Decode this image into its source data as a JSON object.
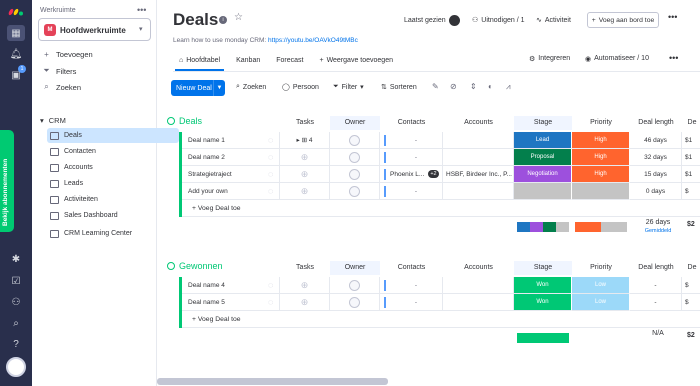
{
  "workspace": {
    "label": "Werkruimte",
    "name": "Hoofdwerkruimte",
    "icon_letter": "M",
    "actions": [
      "Toevoegen",
      "Filters",
      "Zoeken"
    ],
    "folder": "CRM",
    "boards": [
      "Deals",
      "Contacten",
      "Accounts",
      "Leads",
      "Activiteiten",
      "Sales Dashboard",
      "CRM Learning Center"
    ],
    "selected_board": "Deals"
  },
  "rail": {
    "notification_count": "1",
    "subscribe_label": "Bekijk abonnementen"
  },
  "header": {
    "title": "Deals",
    "learn_text": "Learn how to use monday CRM: ",
    "learn_link": "https://youtu.be/OAVkO49tMBc",
    "last_seen": "Laatst gezien",
    "invite": "Uitnodigen / 1",
    "activity": "Activiteit",
    "add_to_board": "Voeg aan bord toe"
  },
  "tabs": [
    "Hoofdtabel",
    "Kanban",
    "Forecast"
  ],
  "add_view": "Weergave toevoegen",
  "integrate": "Integreren",
  "automate": "Automatiseer / 10",
  "toolbar": {
    "new_item": "Nieuw Deal",
    "search": "Zoeken",
    "person": "Persoon",
    "filter": "Filter",
    "sort": "Sorteren"
  },
  "columns": [
    "Tasks",
    "Owner",
    "Contacts",
    "Accounts",
    "Stage",
    "Priority",
    "Deal length",
    "De"
  ],
  "groups": [
    {
      "title": "Deals",
      "color": "#00c875",
      "rows": [
        {
          "name": "Deal name 1",
          "tasks": "4",
          "contacts": "-",
          "accounts": "",
          "stage": "Lead",
          "stage_color": "#1f76c2",
          "priority": "High",
          "priority_color": "#ff642e",
          "length": "46 days",
          "de": "$1"
        },
        {
          "name": "Deal name 2",
          "tasks": "",
          "contacts": "-",
          "accounts": "",
          "stage": "Proposal",
          "stage_color": "#037f4c",
          "priority": "High",
          "priority_color": "#ff642e",
          "length": "32 days",
          "de": "$1"
        },
        {
          "name": "Strategietraject",
          "tasks": "",
          "contacts": "Phoenix L...",
          "contacts_extra": "+2",
          "accounts": "HSBF, Birdeer Inc., P...",
          "stage": "Negotiation",
          "stage_color": "#9d50dd",
          "priority": "High",
          "priority_color": "#ff642e",
          "length": "15 days",
          "de": "$1"
        },
        {
          "name": "Add your own",
          "tasks": "",
          "contacts": "-",
          "accounts": "",
          "stage": "",
          "stage_color": "#c4c4c4",
          "priority": "",
          "priority_color": "#c4c4c4",
          "length": "0 days",
          "de": "$"
        }
      ],
      "add_label": "+ Voeg Deal toe",
      "summary_length": "26 days",
      "summary_sub": "Gemiddeld",
      "summary_de": "$2",
      "stage_summary_colors": [
        "#1f76c2",
        "#9d50dd",
        "#037f4c",
        "#c4c4c4"
      ],
      "priority_summary_colors": [
        "#ff642e",
        "#c4c4c4"
      ]
    },
    {
      "title": "Gewonnen",
      "color": "#00c875",
      "rows": [
        {
          "name": "Deal name 4",
          "tasks": "",
          "contacts": "-",
          "accounts": "",
          "stage": "Won",
          "stage_color": "#00c875",
          "priority": "Low",
          "priority_color": "#9cd9f9",
          "length": "-",
          "de": "$"
        },
        {
          "name": "Deal name 5",
          "tasks": "",
          "contacts": "-",
          "accounts": "",
          "stage": "Won",
          "stage_color": "#00c875",
          "priority": "Low",
          "priority_color": "#9cd9f9",
          "length": "-",
          "de": "$"
        }
      ],
      "add_label": "+ Voeg Deal toe",
      "summary_length": "N/A",
      "summary_sub": "",
      "summary_de": "$2",
      "stage_summary_colors": [
        "#00c875"
      ],
      "priority_summary_colors": [
        "#9cd9f9"
      ]
    }
  ]
}
